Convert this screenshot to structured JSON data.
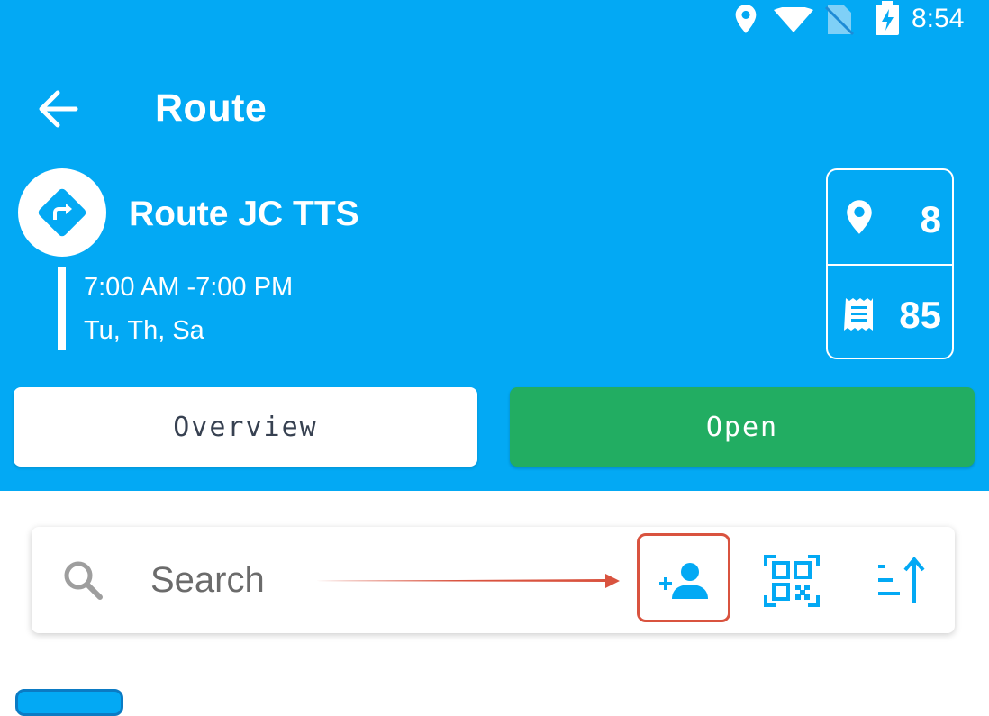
{
  "status_bar": {
    "time": "8:54",
    "icons": [
      "location-icon",
      "wifi-icon",
      "no-sim-icon",
      "battery-charging-icon"
    ]
  },
  "header": {
    "back_icon": "arrow-left-icon",
    "title": "Route"
  },
  "route": {
    "icon": "directions-icon",
    "name": "Route JC TTS",
    "hours": "7:00 AM -7:00 PM",
    "days": "Tu, Th, Sa"
  },
  "stats": {
    "stops_icon": "location-pin-icon",
    "stops": "8",
    "receipts_icon": "receipt-icon",
    "receipts": "85"
  },
  "buttons": {
    "overview": "Overview",
    "open": "Open"
  },
  "search": {
    "placeholder": "Search",
    "value": "",
    "actions": [
      "add-customer-icon",
      "qr-code-scan-icon",
      "sort-icon"
    ]
  },
  "colors": {
    "header_bg": "#03a9f4",
    "open_button": "#22ad62",
    "annotation": "#d9533f",
    "icon_blue": "#03a9f4"
  }
}
